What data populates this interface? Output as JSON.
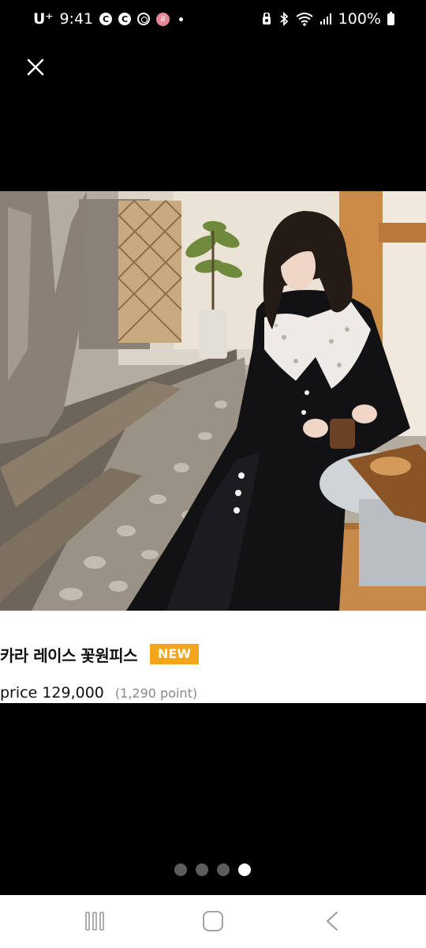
{
  "status_bar": {
    "carrier": "U⁺",
    "time": "9:41",
    "notif_1": "C",
    "notif_2": "C",
    "notif_badge": "클",
    "battery": "100%"
  },
  "viewer": {
    "close_icon": "close-icon"
  },
  "product": {
    "name": "카라 레이스 꽃원피스",
    "badge": "NEW",
    "price": "price 129,000",
    "points": "(1,290 point)"
  },
  "pager": {
    "count": 4,
    "active_index": 3
  },
  "nav_bar": {
    "recents_icon": "recents-icon",
    "home_icon": "home-icon",
    "back_icon": "back-icon"
  },
  "colors": {
    "background": "#000000",
    "badge": "#f3a51c",
    "pager_inactive": "#5d5d5d",
    "pager_active": "#ffffff"
  }
}
